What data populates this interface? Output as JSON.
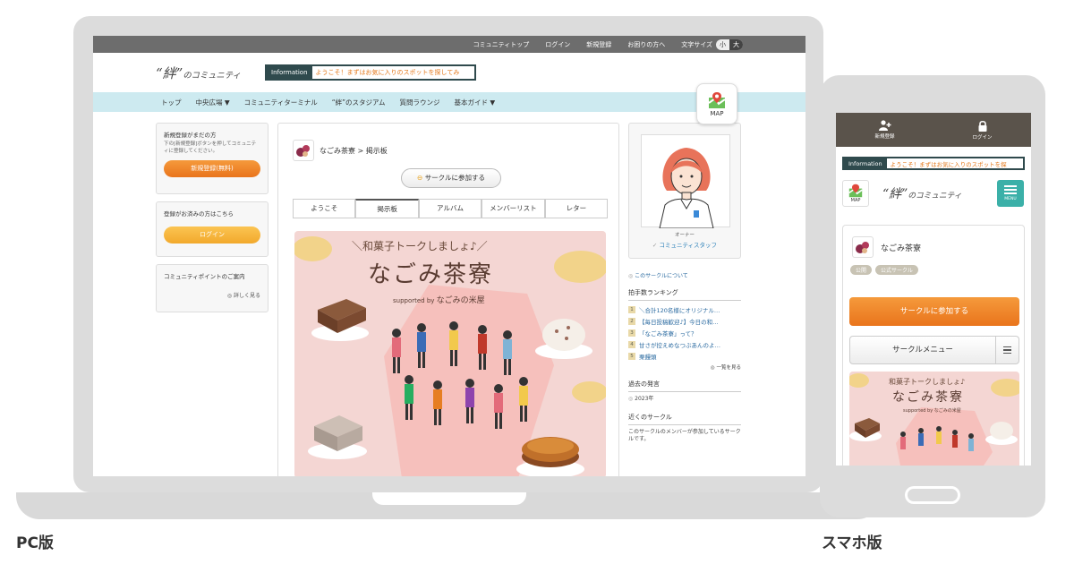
{
  "labels": {
    "pc": "PC版",
    "mobile": "スマホ版"
  },
  "pc": {
    "topbar": {
      "links": [
        "コミュニティトップ",
        "ログイン",
        "新規登録",
        "お困りの方へ"
      ],
      "fontsize_label": "文字サイズ",
      "fontsize_small": "小",
      "fontsize_large": "大"
    },
    "logo": {
      "main": "“絆”",
      "rest": "のコミュニティ"
    },
    "info": {
      "label": "Information",
      "message": "ようこそ！まずはお気に入りのスポットを探してみ"
    },
    "map_label": "MAP",
    "nav": [
      "トップ",
      "中央広場 ▼",
      "コミュニティターミナル",
      "“絆”のスタジアム",
      "質問ラウンジ",
      "基本ガイド ▼"
    ],
    "sidebar": {
      "signup_title": "新規登録がまだの方",
      "signup_desc": "下の[新規登録]ボタンを押してコミュニティに登録してください。",
      "signup_btn": "新規登録(無料)",
      "login_title": "登録がお済みの方はこちら",
      "login_btn": "ログイン",
      "points_title": "コミュニティポイントのご案内",
      "points_more": "詳しく見る"
    },
    "breadcrumb": "なごみ茶寮 > 掲示板",
    "join_btn": "サークルに参加する",
    "tabs": [
      "ようこそ",
      "掲示板",
      "アルバム",
      "メンバーリスト",
      "レター"
    ],
    "banner": {
      "subtitle": "＼和菓子トークしましょ♪／",
      "title": "なごみ茶寮",
      "supported": "supported by",
      "sponsor": "なごみの米屋"
    },
    "right": {
      "owner_role": "オーナー",
      "owner_name": "コミュニティスタッフ",
      "about_link": "このサークルについて",
      "ranking_title": "拍手数ランキング",
      "ranking": [
        "＼合計120名様にオリジナル…",
        "【毎日投稿歓迎♪】今日の和…",
        "「なごみ茶寮」って？",
        "甘さが控えめなつぶあんのよ…",
        "栗饅頭"
      ],
      "ranking_more": "一覧を見る",
      "past_title": "過去の発言",
      "past_year": "2023年",
      "nearby_title": "近くのサークル",
      "nearby_desc": "このサークルのメンバーが参加しているサークルです。"
    }
  },
  "mobile": {
    "top": {
      "signup": "新規登録",
      "login": "ログイン"
    },
    "info": {
      "label": "Information",
      "message": "ようこそ！まずはお気に入りのスポットを探"
    },
    "map_label": "MAP",
    "menu_label": "MENU",
    "circle_name": "なごみ茶寮",
    "tags": [
      "公開",
      "公式サークル"
    ],
    "join_btn": "サークルに参加する",
    "menu_btn": "サークルメニュー",
    "banner": {
      "subtitle": "和菓子トークしましょ♪",
      "title": "なごみ茶寮",
      "supported": "supported by",
      "sponsor": "なごみの米屋"
    }
  },
  "colors": {
    "accent_orange": "#e9741c",
    "nav_bg": "#cdeaf0",
    "info_border": "#2f4a4d",
    "menu_teal": "#3bb0a8"
  }
}
